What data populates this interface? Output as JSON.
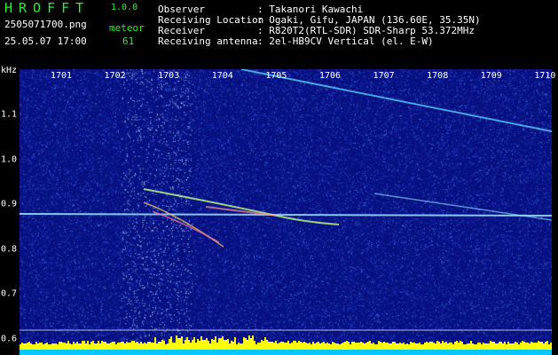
{
  "app": {
    "name": "HROFFT",
    "version": "1.0.0"
  },
  "file": {
    "name": "2505071700.png",
    "datetime": "25.05.07 17:00"
  },
  "meteor": {
    "label": "meteor",
    "count": "61"
  },
  "station": [
    {
      "key": "Observer",
      "value": ": Takanori Kawachi"
    },
    {
      "key": "Receiving Location",
      "value": ": Ogaki, Gifu, JAPAN (136.60E, 35.35N)"
    },
    {
      "key": "Receiver",
      "value": ": R820T2(RTL-SDR) SDR-Sharp 53.372MHz"
    },
    {
      "key": "Receiving antenna",
      "value": ": 2el-HB9CV Vertical (el. E-W)"
    }
  ],
  "spectrogram": {
    "unit": "kHz",
    "x_ticks": [
      "1701",
      "1702",
      "1703",
      "1704",
      "1705",
      "1706",
      "1707",
      "1708",
      "1709",
      "1710"
    ],
    "y_ticks": [
      "1.1",
      "1.0",
      "0.9",
      "0.8",
      "0.7",
      "0.6"
    ],
    "colors": {
      "background": "#061080",
      "bars": "#ffff00",
      "baseline": "#00c8ff",
      "label": "#39e639"
    }
  }
}
